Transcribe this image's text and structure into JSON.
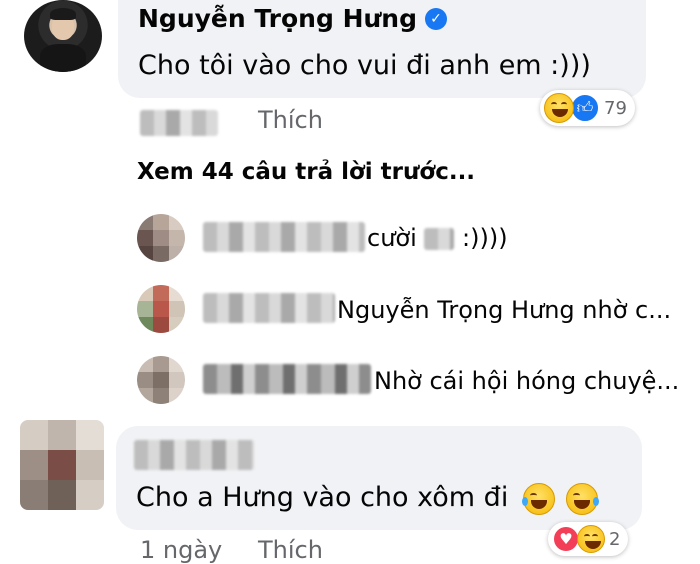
{
  "comment1": {
    "author": "Nguyễn Trọng Hưng",
    "verified_icon": "verified-badge-icon",
    "text": "Cho tôi vào cho vui đi anh em :)))",
    "action_like": "Thích",
    "reaction_count": "79",
    "reaction_icons": [
      "laugh-emoji-icon",
      "like-icon"
    ]
  },
  "view_replies": "Xem 44 câu trả lời trước...",
  "replies": [
    {
      "text": "cười",
      "suffix": ":))))"
    },
    {
      "text": "Nguyễn Trọng Hưng nhờ c..."
    },
    {
      "text": "Nhờ cái hội hóng chuyệ..."
    }
  ],
  "comment2": {
    "text": "Cho a Hưng vào cho xôm đi",
    "action_time": "1 ngày",
    "action_like": "Thích",
    "reaction_count": "2",
    "reaction_icons": [
      "heart-icon",
      "laugh-emoji-icon"
    ]
  },
  "colors": {
    "bubble": "#f0f2f5",
    "verified": "#1877f2",
    "like": "#1877f2",
    "heart": "#f33e58",
    "meta": "#65676b"
  }
}
